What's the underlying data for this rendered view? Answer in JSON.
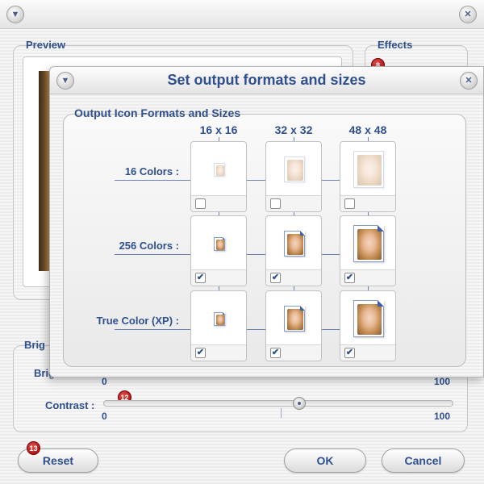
{
  "main": {
    "preview_title": "Preview",
    "effects_title": "Effects",
    "effects_badge": "8",
    "bright_title_partial": "Brig",
    "brightness": {
      "label": "Brightness :",
      "min": "0",
      "max": "100"
    },
    "contrast": {
      "label": "Contrast :",
      "badge": "12",
      "value": 0.5,
      "min": "0",
      "max": "100"
    },
    "buttons": {
      "reset": "Reset",
      "reset_badge": "13",
      "ok": "OK",
      "cancel": "Cancel"
    },
    "icons": {
      "menu": "chevron-down-icon",
      "close": "close-icon"
    }
  },
  "dialog": {
    "title": "Set output formats and sizes",
    "group_title": "Output Icon Formats and Sizes",
    "columns": [
      "16 x 16",
      "32 x 32",
      "48 x 48"
    ],
    "rows": [
      {
        "label": "16 Colors :",
        "checked": [
          false,
          false,
          false
        ]
      },
      {
        "label": "256 Colors :",
        "checked": [
          true,
          true,
          true
        ]
      },
      {
        "label": "True Color (XP) :",
        "checked": [
          true,
          true,
          true
        ]
      }
    ]
  },
  "colors": {
    "accent_text": "#2f4f8f",
    "badge_red": "#b00000",
    "connector": "#6d83b5"
  }
}
